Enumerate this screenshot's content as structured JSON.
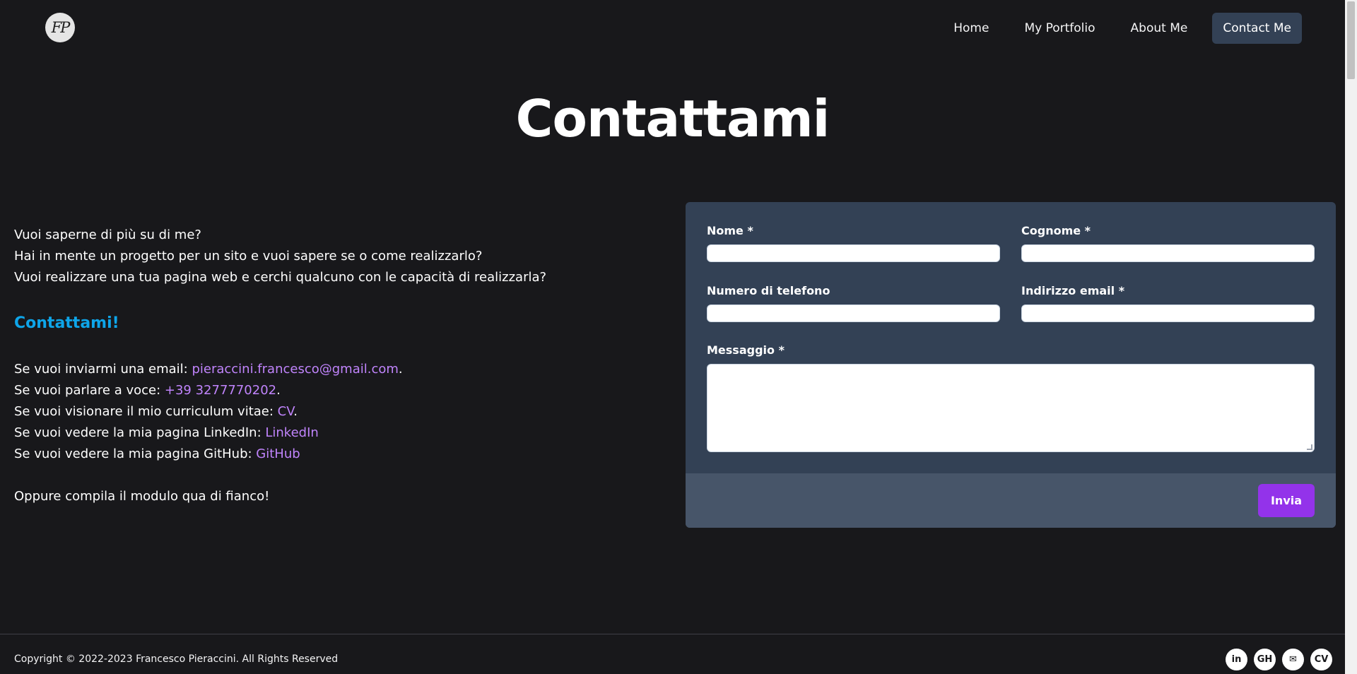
{
  "header": {
    "logo_text": "FP",
    "nav": [
      {
        "label": "Home"
      },
      {
        "label": "My Portfolio"
      },
      {
        "label": "About Me"
      },
      {
        "label": "Contact Me",
        "active": true
      }
    ]
  },
  "page_title": "Contattami",
  "intro": {
    "lines": [
      "Vuoi saperne di più su di me?",
      "Hai in mente un progetto per un sito e vuoi sapere se o come realizzarlo?",
      "Vuoi realizzare una tua pagina web e cerchi qualcuno con le capacità di realizzarla?"
    ],
    "heading": "Contattami!",
    "contacts": [
      {
        "prefix": "Se vuoi inviarmi una email: ",
        "link": "pieraccini.francesco@gmail.com",
        "suffix": "."
      },
      {
        "prefix": "Se vuoi parlare a voce: ",
        "link": "+39 3277770202",
        "suffix": "."
      },
      {
        "prefix": "Se vuoi visionare il mio curriculum vitae: ",
        "link": "CV",
        "suffix": "."
      },
      {
        "prefix": "Se vuoi vedere la mia pagina LinkedIn: ",
        "link": "LinkedIn",
        "suffix": ""
      },
      {
        "prefix": "Se vuoi vedere la mia pagina GitHub: ",
        "link": "GitHub",
        "suffix": ""
      }
    ],
    "closing": "Oppure compila il modulo qua di fianco!"
  },
  "form": {
    "nome_label": "Nome *",
    "cognome_label": "Cognome *",
    "telefono_label": "Numero di telefono",
    "email_label": "Indirizzo email *",
    "messaggio_label": "Messaggio *",
    "submit_label": "Invia"
  },
  "footer": {
    "copyright": "Copyright © 2022-2023 Francesco Pieraccini. All Rights Reserved",
    "social": [
      {
        "icon": "linkedin-icon",
        "glyph": "in"
      },
      {
        "icon": "github-icon",
        "glyph": "GH"
      },
      {
        "icon": "mail-icon",
        "glyph": "✉"
      },
      {
        "icon": "cv-icon",
        "glyph": "CV"
      }
    ]
  },
  "colors": {
    "background": "#18181b",
    "card": "#334155",
    "card_footer": "#475569",
    "accent_heading": "#0ea5e9",
    "link": "#c084fc",
    "button": "#9333ea"
  }
}
